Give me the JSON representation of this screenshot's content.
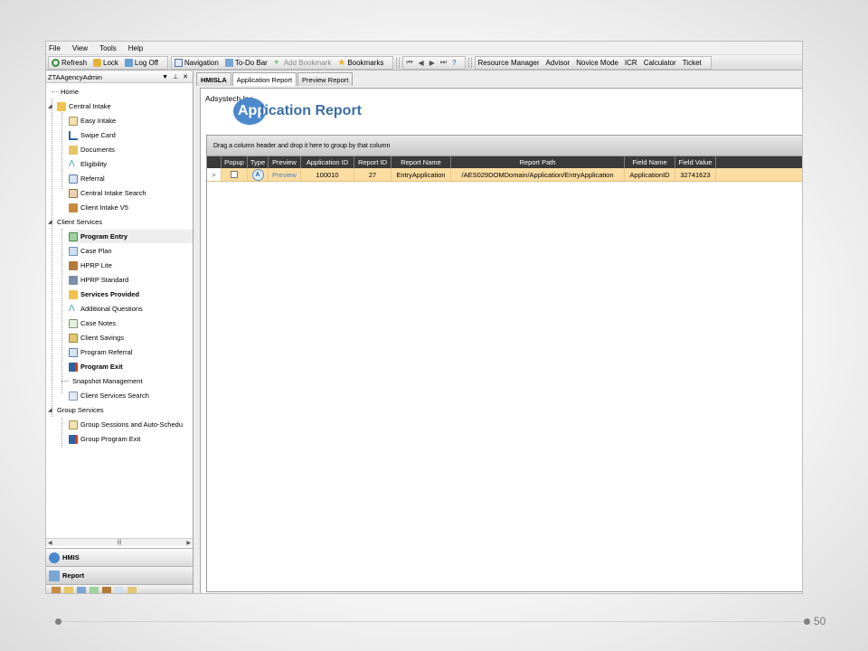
{
  "menu": [
    "File",
    "View",
    "Tools",
    "Help"
  ],
  "toolbar": {
    "refresh": "Refresh",
    "lock": "Lock",
    "logoff": "Log Off",
    "navigation": "Navigation",
    "todo": "To-Do Bar",
    "add_bookmark": "Add Bookmark",
    "bookmarks": "Bookmarks",
    "resource_manager": "Resource Manager",
    "advisor": "Advisor",
    "novice_mode": "Novice Mode",
    "icr": "ICR",
    "calculator": "Calculator",
    "ticket": "Ticket"
  },
  "left": {
    "agency": "ZTAAgencyAdmin",
    "tree": [
      {
        "label": "Home"
      },
      {
        "label": "Central Intake"
      },
      {
        "label": "Easy Intake"
      },
      {
        "label": "Swipe Card"
      },
      {
        "label": "Documents"
      },
      {
        "label": "Eligibility"
      },
      {
        "label": "Referral"
      },
      {
        "label": "Central Intake Search"
      },
      {
        "label": "Client Intake V5"
      },
      {
        "label": "Client Services"
      },
      {
        "label": "Program Entry"
      },
      {
        "label": "Case Plan"
      },
      {
        "label": "HPRP Lite"
      },
      {
        "label": "HPRP Standard"
      },
      {
        "label": "Services Provided"
      },
      {
        "label": "Additional Questions"
      },
      {
        "label": "Case Notes"
      },
      {
        "label": "Client Savings"
      },
      {
        "label": "Program Referral"
      },
      {
        "label": "Program Exit"
      },
      {
        "label": "Snapshot Management"
      },
      {
        "label": "Client Services Search"
      },
      {
        "label": "Group Services"
      },
      {
        "label": "Group Sessions and Auto-Schedu"
      },
      {
        "label": "Group Program Exit"
      }
    ],
    "bottom": [
      "HMIS",
      "Report"
    ]
  },
  "tabs": [
    "HMISLA",
    "Application Report",
    "Preview Report"
  ],
  "report": {
    "brand": "Adsystech Inc",
    "logo_letters": "App",
    "logo_rest": "lication Report",
    "group_hint": "Drag a column header and drop it here to group by that column",
    "columns": [
      "Popup",
      "Type",
      "Preview",
      "Application ID",
      "Report ID",
      "Report Name",
      "Report Path",
      "Field Name",
      "Field Value"
    ],
    "row": {
      "expander": ">",
      "type": "A",
      "preview": "Preview",
      "application_id": "100010",
      "report_id": "27",
      "report_name": "EntryApplication",
      "report_path": "/AES029DOMDomain/Application/EntryApplication",
      "field_name": "ApplicationID",
      "field_value": "32741623"
    }
  },
  "slide": {
    "page_number": "50"
  },
  "colors": {
    "accent": "#4b88cc",
    "row_highlight": "#fbdda2",
    "header": "#3a3a3a"
  }
}
